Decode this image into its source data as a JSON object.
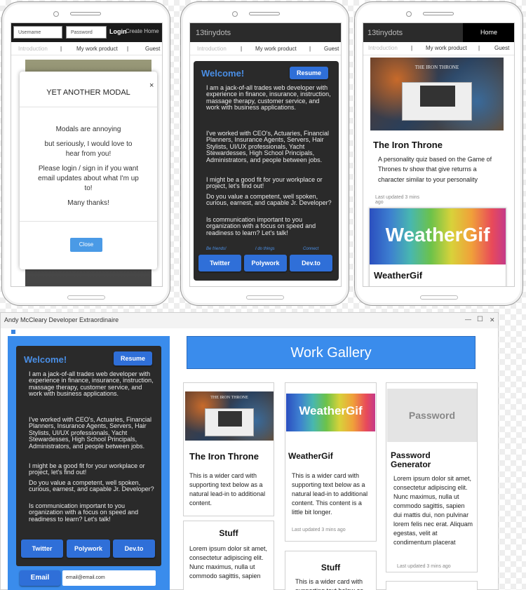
{
  "phone1": {
    "username_placeholder": "Username",
    "password_placeholder": "Password",
    "login": "Login",
    "create_home": "Create Home",
    "nav": [
      "Introduction",
      "My work product",
      "Guest"
    ],
    "modal": {
      "title": "YET ANOTHER MODAL",
      "close_x": "×",
      "lines": [
        "Modals are annoying",
        "but seriously, I would love to hear from you!",
        "Please login / sign in if you want email updates about what I'm up to!",
        "Many thanks!"
      ],
      "close_button": "Close"
    }
  },
  "phone2": {
    "brand": "13tinydots",
    "nav": [
      "Introduction",
      "My work product",
      "Guest"
    ]
  },
  "intro": {
    "welcome": "Welcome!",
    "resume": "Resume",
    "paragraphs": [
      "I am a jack-of-all trades web developer with experience in finance, insurance, instruction, massage therapy, customer service, and work with business applications.",
      "I've worked with CEO's, Actuaries, Financial Planners, Insurance Agents, Servers, Hair Stylists, UI/UX professionals, Yacht Stewardesses, High School Principals, Administrators, and people between jobs.",
      "I might be a good fit for your workplace or project, let's find out!",
      "Do you value a competent, well spoken, curious, earnest, and capable Jr. Developer?",
      "Is communication important to you organization with a focus on speed and readiness to learn? Let's talk!"
    ],
    "labels": [
      "Be friends!",
      "I do things",
      "Connect"
    ],
    "buttons": [
      "Twitter",
      "Polywork",
      "Dev.to"
    ]
  },
  "phone3": {
    "brand": "13tinydots",
    "home": "Home",
    "nav": [
      "Introduction",
      "My work product",
      "Guest"
    ],
    "card1": {
      "title": "The Iron Throne",
      "text": "A personality quiz based on the Game of Thrones tv show that give returns a character similar to your personality",
      "updated": "Last updated 3 mins ago"
    },
    "card2": {
      "image_text": "WeatherGif",
      "title": "WeatherGif"
    }
  },
  "thumb": {
    "iron_throne": "THE IRON THRONE"
  },
  "desktop": {
    "window_title": "Andy McCleary Developer Extraordinaire",
    "controls": [
      "—",
      "☐",
      "✕"
    ],
    "email_button": "Email",
    "email_placeholder": "email@email.com",
    "gallery_title": "Work Gallery",
    "cards": [
      {
        "title": "The Iron Throne",
        "text": "This is a wider card with supporting text below as a natural lead-in to additional content."
      },
      {
        "image_text": "WeatherGif",
        "title": "WeatherGif",
        "text": "This is a wider card with supporting text below as a natural lead-in to additional content. This content is a little bit longer.",
        "updated": "Last updated 3 mins ago"
      },
      {
        "image_text": "Password",
        "title": "Password Generator",
        "text": "Lorem ipsum dolor sit amet, consectetur adipiscing elit. Nunc maximus, nulla ut commodo sagittis, sapien dui mattis dui, non pulvinar lorem felis nec erat. Aliquam egestas, velit at condimentum placerat",
        "updated": "Last updated 3 mins ago"
      },
      {
        "title": "Stuff",
        "text": "Lorem ipsum dolor sit amet, consectetur adipiscing elit. Nunc maximus, nulla ut commodo sagittis, sapien"
      },
      {
        "title": "Stuff",
        "text": "This is a wider card with supporting text below as"
      }
    ]
  }
}
